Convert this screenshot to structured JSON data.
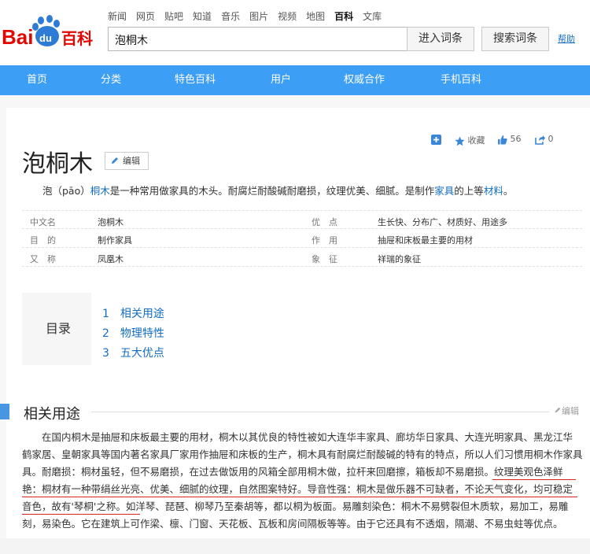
{
  "logo": {
    "text_bai": "Bai",
    "text_du": "du",
    "text_baike": "百科"
  },
  "topnav": [
    "新闻",
    "网页",
    "贴吧",
    "知道",
    "音乐",
    "图片",
    "视频",
    "地图",
    "百科",
    "文库"
  ],
  "topnav_active": "百科",
  "search": {
    "value": "泡桐木",
    "enter_label": "进入词条",
    "search_label": "搜索词条",
    "help": "帮助"
  },
  "mainnav": [
    "首页",
    "分类",
    "特色百科",
    "用户",
    "权威合作",
    "手机百科"
  ],
  "entry": {
    "title": "泡桐木",
    "edit_label": "编辑",
    "collect_label": "收藏",
    "like_count": "56",
    "share_count": "0"
  },
  "summary": {
    "part1": "泡（pāo）",
    "link1": "桐木",
    "part2": "是一种常用做家具的木头。耐腐烂耐酸碱耐磨损，纹理优美、细腻。是制作",
    "link2": "家具",
    "part3": "的上等",
    "link3": "材料",
    "part4": "。"
  },
  "infobox": [
    {
      "k1": "中文名",
      "v1": "泡桐木",
      "k2": "优　点",
      "v2": "生长快、分布广、材质好、用途多"
    },
    {
      "k1": "目　的",
      "v1": "制作家具",
      "k2": "作　用",
      "v2": "抽屉和床板最主要的用材"
    },
    {
      "k1": "又　称",
      "v1": "凤凰木",
      "k2": "象　征",
      "v2": "祥瑞的象征"
    }
  ],
  "toc": {
    "title": "目录",
    "items": [
      "1　相关用途",
      "2　物理特性",
      "3　五大优点"
    ]
  },
  "section": {
    "title": "相关用途",
    "edit_label": "编辑"
  },
  "paragraph_lines": [
    "在国内桐木是抽屉和床板最主要的用材，桐木以其优良的特性被如大连华丰家具、廊坊华日家具、大连光明家具、黑龙江华",
    "鹤家居、皇朝家具等国内著名家具厂家用作抽屉和床板的生产，桐木具有耐腐烂耐酸碱的特有的特点，所以人们习惯用桐木作家具",
    "具。耐磨损：桐材虽轻，但不易磨损，在过去做饭用的风箱全部用桐木做，拉杆来回磨擦，箱板却不易磨损。纹理美观色泽鲜",
    "艳：桐材有一种带绢丝光亮、优美、细腻的纹理，自然图案特好。导音性强：桐木是做乐器不可缺者，不论天气变化，均可稳定",
    "音色，故有'琴桐'之称。如洋琴、琵琶、柳琴乃至秦胡等，都以桐为板面。易雕刻染色：桐木不易劈裂但木质软，易加工，易雕",
    "刻，易染色。它在建筑上可作梁、檩、门窗、天花板、瓦板和房间隔板等等。由于它还具有不透烟，隔潮、不易虫蛀等优点。"
  ],
  "colors": {
    "brand_blue": "#2e7bd6",
    "brand_red": "#e10601",
    "nav_blue": "#3d9ef5",
    "link": "#136ec2"
  }
}
